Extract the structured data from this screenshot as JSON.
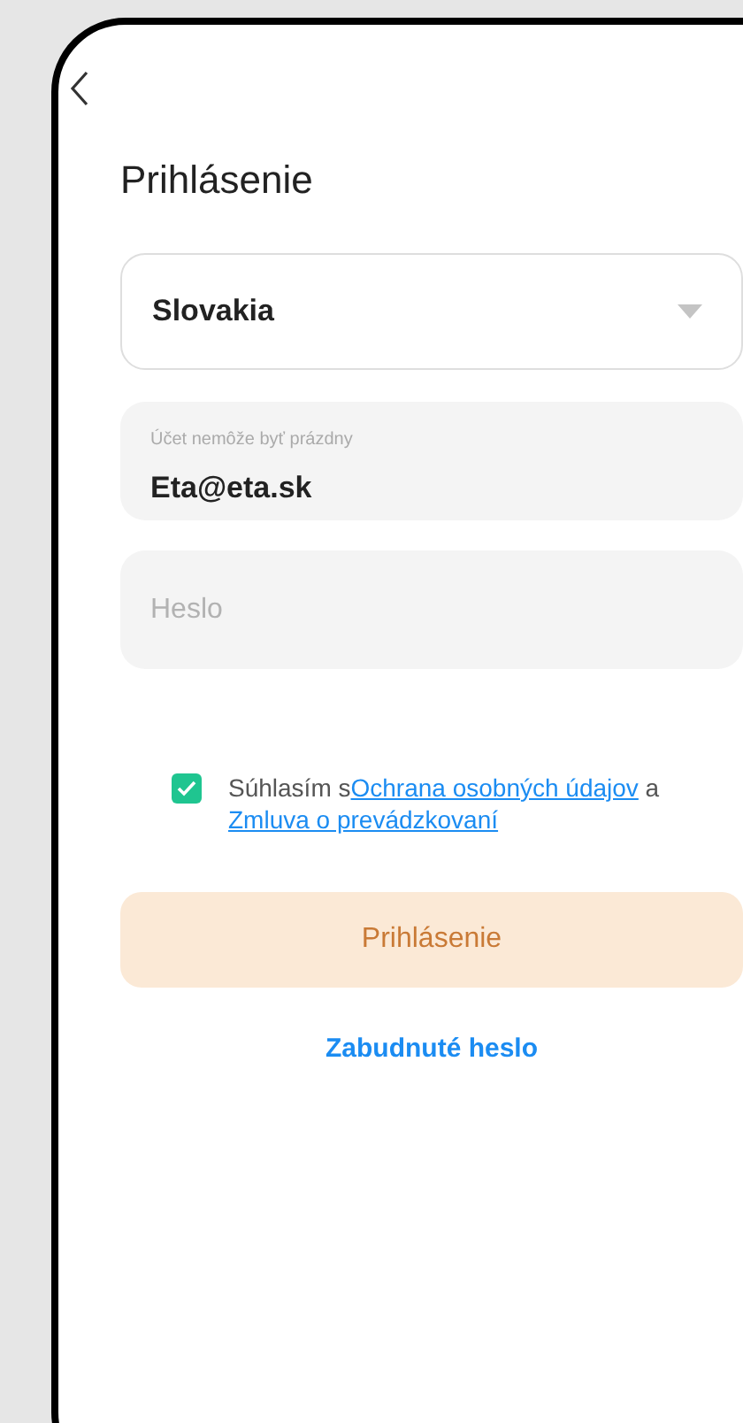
{
  "title": "Prihlásenie",
  "region": {
    "value": "Slovakia"
  },
  "account": {
    "label": "Účet nemôže byť prázdny",
    "value": "Eta@eta.sk"
  },
  "password": {
    "placeholder": "Heslo"
  },
  "consent": {
    "checked": true,
    "text": "Súhlasím s",
    "link_1": "Ochrana osobných údajov",
    "middle": " a ",
    "link_2": "Zmluva o prevádzkovaní"
  },
  "login_button": {
    "label": "Prihlásenie",
    "disabled": true
  },
  "forgot_link": "Zabudnuté heslo"
}
